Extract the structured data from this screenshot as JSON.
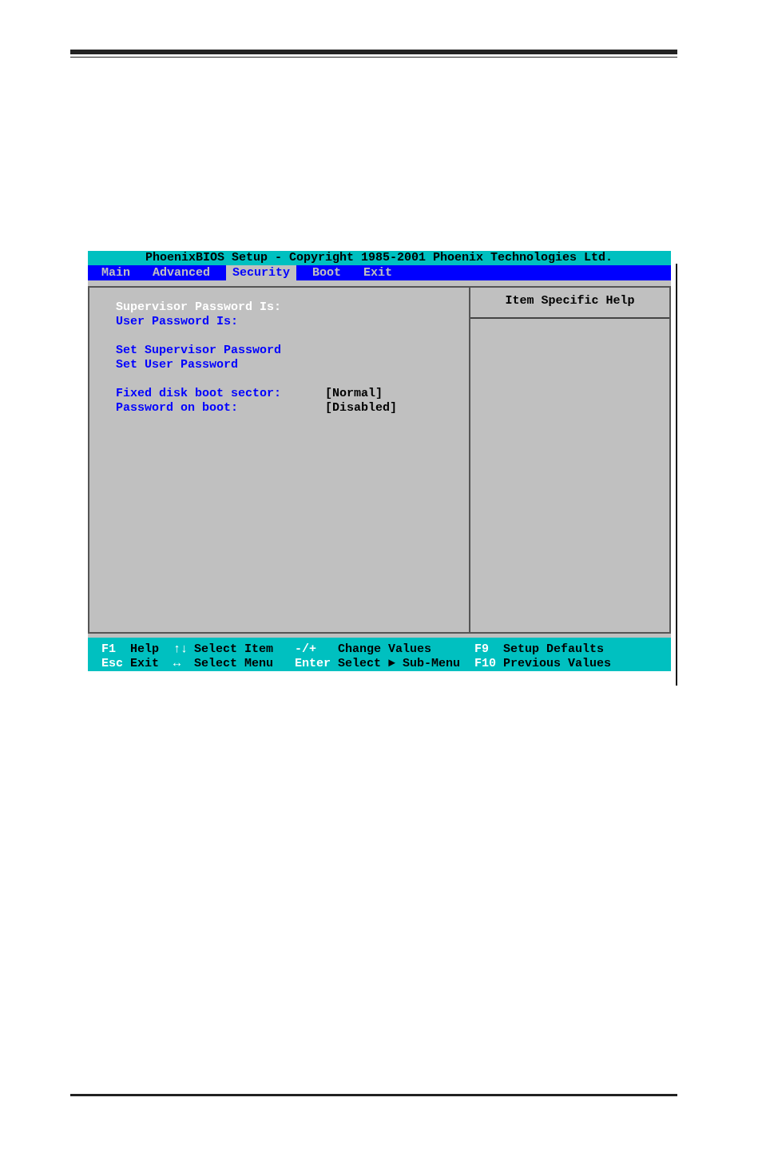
{
  "window": {
    "title": "PhoenixBIOS Setup - Copyright 1985-2001 Phoenix Technologies Ltd."
  },
  "tabs": [
    {
      "label": "Main",
      "selected": false
    },
    {
      "label": "Advanced",
      "selected": false
    },
    {
      "label": "Security",
      "selected": true
    },
    {
      "label": "Boot",
      "selected": false
    },
    {
      "label": "Exit",
      "selected": false
    }
  ],
  "settings": [
    [
      {
        "label": "Supervisor Password Is:",
        "selected": true
      },
      {
        "label": "User Password Is:",
        "selected": false
      }
    ],
    [
      {
        "label": "Set Supervisor Password",
        "selected": false
      },
      {
        "label": "Set User Password",
        "selected": false
      }
    ],
    [
      {
        "label": "Fixed disk boot sector:",
        "value": "[Normal]",
        "selected": false
      },
      {
        "label": "Password on boot:",
        "value": "[Disabled]",
        "selected": false
      }
    ]
  ],
  "help_panel": {
    "title": "Item Specific Help"
  },
  "status_bar": [
    {
      "key": "F1",
      "action": "Help"
    },
    {
      "key": "↑↓",
      "action": "Select Item"
    },
    {
      "key": "-/+",
      "action": "Change Values"
    },
    {
      "key": "F9",
      "action": "Setup Defaults"
    },
    {
      "key": "Esc",
      "action": "Exit"
    },
    {
      "key": "↔",
      "action": "Select Menu"
    },
    {
      "key": "Enter",
      "action": "Select ► Sub-Menu"
    },
    {
      "key": "F10",
      "action": "Previous Values"
    }
  ]
}
